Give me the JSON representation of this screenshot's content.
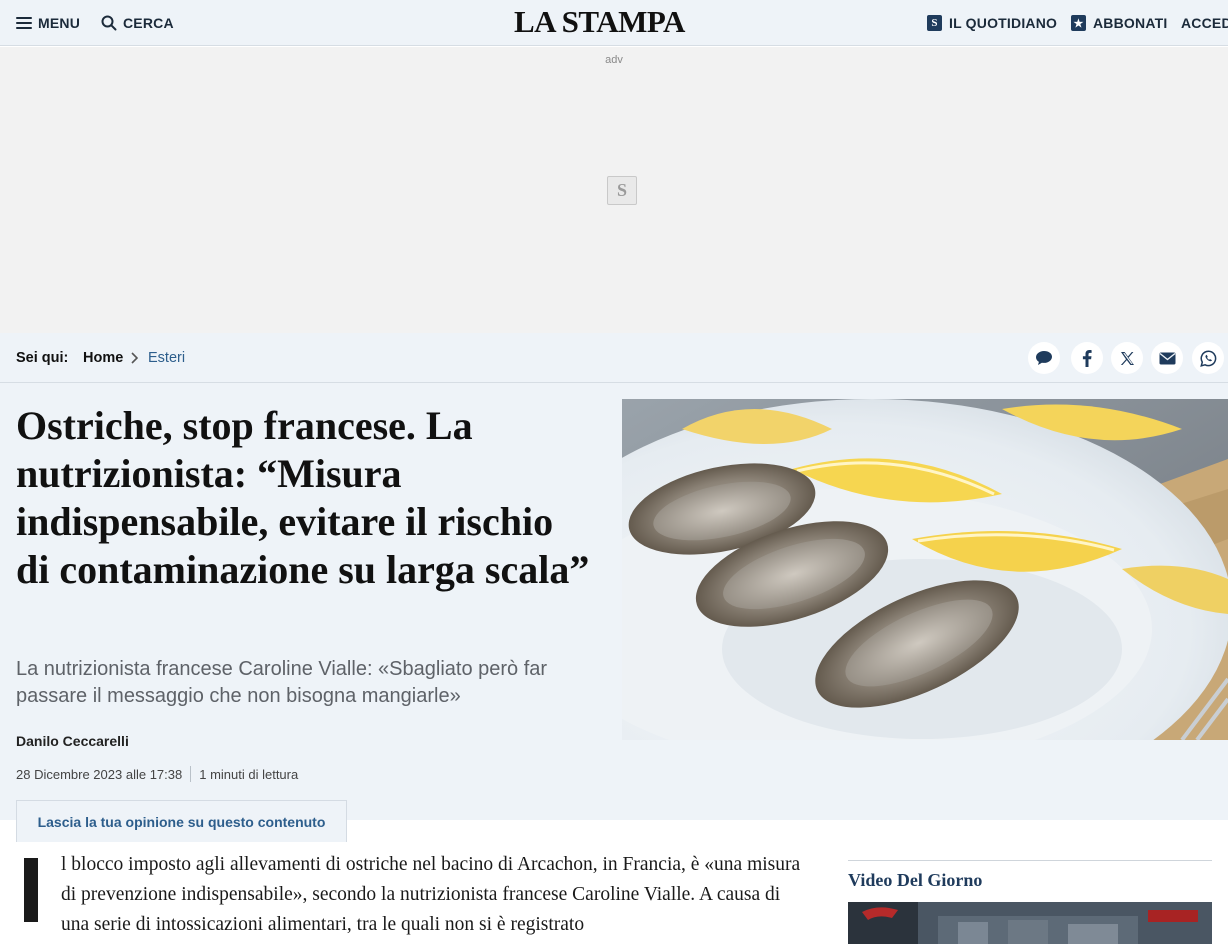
{
  "header": {
    "menu_label": "MENU",
    "search_label": "CERCA",
    "logo": "LA STAMPA",
    "quotidiano_label": "IL QUOTIDIANO",
    "abbonati_label": "ABBONATI",
    "accedi_label": "ACCEDI",
    "badge_letter": "S"
  },
  "ad": {
    "label": "adv",
    "logo_letter": "S"
  },
  "breadcrumb": {
    "label": "Sei qui:",
    "home": "Home",
    "separator": "›",
    "current": "Esteri"
  },
  "share": {
    "icons": [
      "comment-icon",
      "facebook-icon",
      "x-icon",
      "email-icon",
      "whatsapp-icon"
    ]
  },
  "article": {
    "title": "Ostriche, stop francese. La nutrizionista: “Misura indispensabile, evitare il rischio di contaminazione su larga scala”",
    "subtitle": "La nutrizionista francese Caroline Vialle: «Sbagliato però far passare il messaggio che non bisogna mangiarle»",
    "author": "Danilo Ceccarelli",
    "date": "28 Dicembre 2023 alle 17:38",
    "reading_time": "1 minuti di lettura",
    "opinion_label": "Lascia la tua opinione su questo contenuto",
    "body_first": "l blocco imposto agli allevamenti di ostriche nel bacino di Arcachon, in Francia, è «una misura di prevenzione indispensabile», secondo la nutrizionista francese Caroline Vialle. A causa di una serie di intossicazioni alimentari, tra le quali non si è registrato"
  },
  "sidebar": {
    "video_title": "Video Del Giorno"
  },
  "colors": {
    "accent": "#2d5e8c",
    "navy": "#1f3b5c",
    "light_bg": "#eef3f8"
  }
}
